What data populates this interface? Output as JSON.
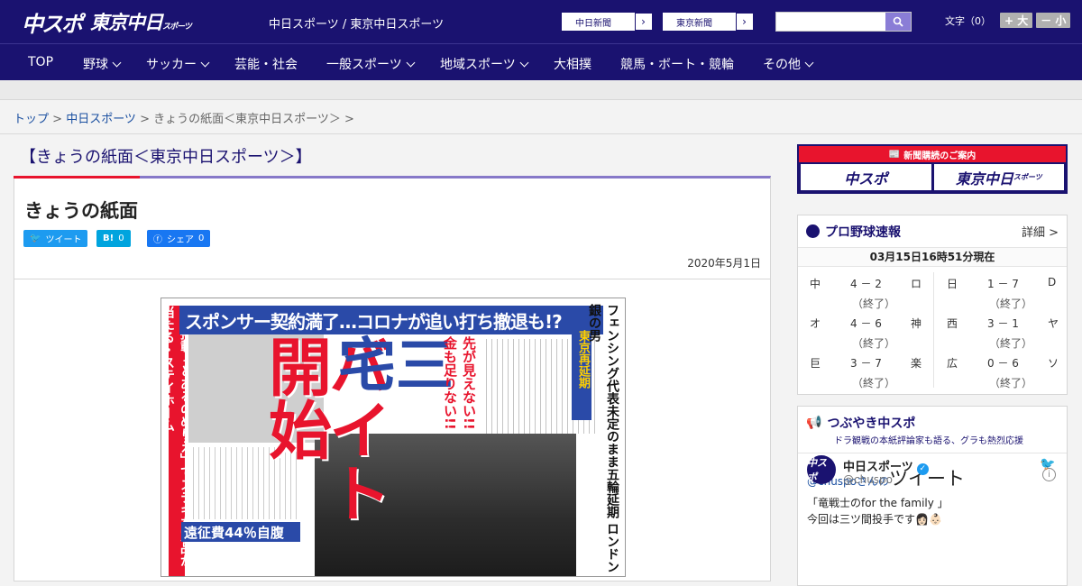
{
  "header": {
    "logo_main": "中スポ",
    "logo_tokyo": "東京中日",
    "logo_tokyo_small": "スポーツ",
    "site_links": "中日スポーツ / 東京中日スポーツ",
    "paper_links": [
      "中日新聞",
      "東京新聞"
    ],
    "search": {
      "placeholder": ""
    },
    "font_label": "文字（0）",
    "font_plus": "+ 大",
    "font_minus": "－ 小"
  },
  "nav": {
    "items": [
      {
        "label": "TOP",
        "dropdown": false
      },
      {
        "label": "野球",
        "dropdown": true
      },
      {
        "label": "サッカー",
        "dropdown": true
      },
      {
        "label": "芸能・社会",
        "dropdown": false
      },
      {
        "label": "一般スポーツ",
        "dropdown": true
      },
      {
        "label": "地域スポーツ",
        "dropdown": true
      },
      {
        "label": "大相撲",
        "dropdown": false
      },
      {
        "label": "競馬・ボート・競輪",
        "dropdown": false
      },
      {
        "label": "その他",
        "dropdown": true
      }
    ]
  },
  "breadcrumb": {
    "top": "トップ",
    "sep": " > ",
    "chunichi": "中日スポーツ",
    "current": "きょうの紙面＜東京中日スポーツ＞ >"
  },
  "page": {
    "heading": "【きょうの紙面＜東京中日スポーツ＞】",
    "title": "きょうの紙面",
    "date": "2020年5月1日"
  },
  "share": {
    "tweet_label": "ツイート",
    "hatena_label": "B!",
    "hatena_count": "0",
    "facebook_label": "シェア",
    "facebook_count": "0"
  },
  "newspaper": {
    "headline": "スポンサー契約満了…コロナが追い打ち撤退も!?",
    "big_red": "バイト開始",
    "big_blue": "三宅",
    "sub_red": "先が見えない!! 金も足りない!!",
    "left_col": "5日掲載「とあるのめりえ」でステキな賞品が当たる・ステイホーム",
    "right_col": "フェンシング代表未定のまま五輪延期 ロンドン銀の男",
    "blue_box": "遠征費44％自腹",
    "yellow_box": "東京再延期"
  },
  "sidebar": {
    "ad_head": "新聞購読のご案内",
    "ad_btn1": "中スポ",
    "ad_btn2": "東京中日",
    "ad_btn2_small": "スポーツ",
    "baseball_title": "プロ野球速報",
    "baseball_more": "詳細 >",
    "baseball_time": "03月15日16時51分現在",
    "games": [
      {
        "left": "中",
        "score": "4 － 2",
        "right": "ロ",
        "status": "（終了）"
      },
      {
        "left": "日",
        "score": "1 － 7",
        "right": "D",
        "status": "（終了）"
      },
      {
        "left": "オ",
        "score": "4 － 6",
        "right": "神",
        "status": "（終了）"
      },
      {
        "left": "西",
        "score": "3 － 1",
        "right": "ヤ",
        "status": "（終了）"
      },
      {
        "left": "巨",
        "score": "3 － 7",
        "right": "楽",
        "status": "（終了）"
      },
      {
        "left": "広",
        "score": "0 － 6",
        "right": "ソ",
        "status": "（終了）"
      }
    ],
    "tweet_box_title": "つぶやき中スポ",
    "tweet_box_sub": "ドラ観戦の本紙評論家も語る、グラも熱烈応援",
    "tweet_handle_line": "@chuspoさんの",
    "tweet_word": "ツイート",
    "tweet_user": "中日スポーツ",
    "tweet_at": "@chuspo",
    "tweet_avatar": "中スポ",
    "tweet_text1": "「竜戦士のfor the family 」",
    "tweet_text2": "今回は三ツ間投手です👩🏻👶🏻"
  }
}
